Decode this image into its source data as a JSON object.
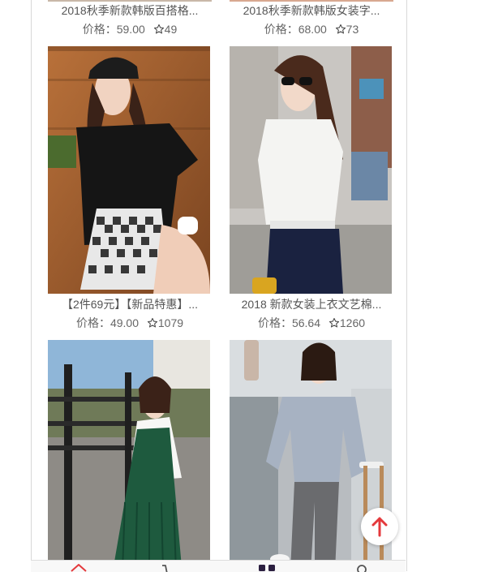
{
  "price_label": "价格：",
  "products": [
    {
      "title": "2018秋季新款韩版百搭格...",
      "price": "59.00",
      "likes": "49"
    },
    {
      "title": "2018秋季新款韩版女装字...",
      "price": "68.00",
      "likes": "73"
    },
    {
      "title": "【2件69元】【新品特惠】...",
      "price": "49.00",
      "likes": "1079"
    },
    {
      "title": "2018 新款女装上衣文艺棉...",
      "price": "56.64",
      "likes": "1260"
    },
    {
      "title": "",
      "price": "",
      "likes": ""
    },
    {
      "title": "",
      "price": "",
      "likes": ""
    }
  ],
  "colors": {
    "accent": "#e4393c",
    "text": "#555555",
    "tabbar_bg": "#f8f8f8",
    "border": "#d8d8d8"
  },
  "icons": {
    "star": "star-outline-icon",
    "backtop": "arrow-up-icon",
    "tabs": [
      "home-icon",
      "cart-icon",
      "category-icon",
      "profile-icon"
    ]
  }
}
